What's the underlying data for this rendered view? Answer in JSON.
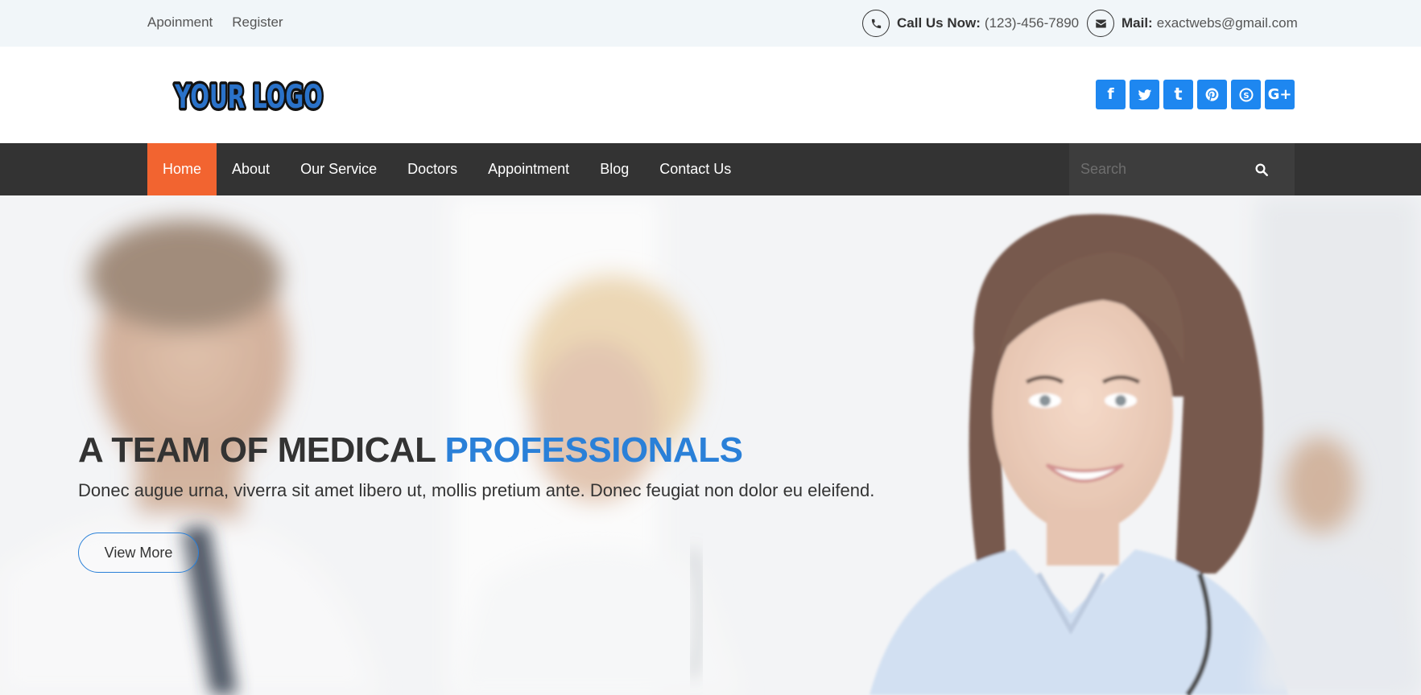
{
  "topbar": {
    "links": [
      "Apoinment",
      "Register"
    ],
    "phone_label": "Call Us Now:",
    "phone_value": "(123)-456-7890",
    "mail_label": "Mail:",
    "mail_value": "exactwebs@gmail.com"
  },
  "header": {
    "logo_text": "YOUR LOGO",
    "social": [
      {
        "name": "facebook-icon",
        "glyph": "f"
      },
      {
        "name": "twitter-icon",
        "glyph": "t"
      },
      {
        "name": "tumblr-icon",
        "glyph": "t"
      },
      {
        "name": "pinterest-icon",
        "glyph": "P"
      },
      {
        "name": "skype-icon",
        "glyph": "S"
      },
      {
        "name": "google-plus-icon",
        "glyph": "G+"
      }
    ]
  },
  "nav": {
    "items": [
      "Home",
      "About",
      "Our Service",
      "Doctors",
      "Appointment",
      "Blog",
      "Contact Us"
    ],
    "active": "Home",
    "search_placeholder": "Search"
  },
  "hero": {
    "headline_main": "A TEAM OF MEDICAL ",
    "headline_accent": "PROFESSIONALS",
    "subtitle": "Donec augue urna, viverra sit amet libero ut, mollis pretium ante. Donec feugiat non dolor eu eleifend.",
    "button_label": "View More"
  },
  "colors": {
    "accent_blue": "#2a80d8",
    "nav_active": "#f26430",
    "nav_bg": "#333333",
    "social_blue": "#1e87f0",
    "topbar_bg": "#f1f6f9"
  }
}
